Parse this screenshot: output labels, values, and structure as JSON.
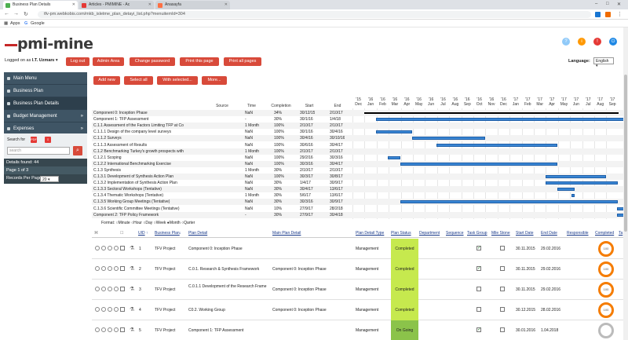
{
  "browser": {
    "tabs": [
      {
        "title": "Business Plan Details",
        "color": "#4caf50"
      },
      {
        "title": "Articles - PMIMINE - Ac",
        "color": "#e53935"
      },
      {
        "title": "Anasayfa",
        "color": "#ff7043"
      }
    ],
    "url": "tfv-pm.webkobis.com/mkb_isletme_plan_detayi_list.php?menuitemId=304",
    "bookmarks": [
      "Apps",
      "Google"
    ]
  },
  "logo": "pmi-mine",
  "header": {
    "logged_prefix": "Logged on as",
    "logged_user": "I.T. Uzmanı",
    "buttons": [
      "Log out",
      "Admin Area",
      "Change password",
      "Print this page",
      "Print all pages"
    ],
    "language_label": "Language:",
    "language_value": "English"
  },
  "sidebar": {
    "items": [
      {
        "label": "Main Menu"
      },
      {
        "label": "Business Plan"
      },
      {
        "label": "Business Plan Details"
      },
      {
        "label": "Budget Management"
      },
      {
        "label": "Expenses"
      }
    ],
    "search_for": "Search for",
    "search_placeholder": "search",
    "details_found": "Details found: 44",
    "page_of": "Page 1 of 3",
    "records_label": "Records Per Page:",
    "records_value": "20"
  },
  "actions": [
    "Add new",
    "Select all",
    "With selected...",
    "More..."
  ],
  "gantt": {
    "columns": [
      "Source",
      "Time",
      "Completion",
      "Start",
      "End"
    ],
    "months": [
      "'15 Dec",
      "'16 Jan",
      "'16 Feb",
      "'16 Mar",
      "'16 Apr",
      "'16 May",
      "'16 Jun",
      "'16 Jul",
      "'16 Aug",
      "'16 Sep",
      "'16 Oct",
      "'16 Nov",
      "'16 Dec",
      "'17 Jan",
      "'17 Feb",
      "'17 Mar",
      "'17 Apr",
      "'17 May",
      "'17 Jun",
      "'17 Jul",
      "'17 Aug",
      "'17 Sep"
    ],
    "rows": [
      {
        "name": "Component 0: Inception Phase",
        "source": "",
        "time": "NaN",
        "comp": "34%",
        "start": "30/12/15",
        "end": "2/10/17"
      },
      {
        "name": "Component 1: TFP Assessment",
        "source": "",
        "time": "-",
        "comp": "30%",
        "start": "30/1/16",
        "end": "1/4/18"
      },
      {
        "name": "C.1.1 Assessment of the Factors Limiting TFP at Co",
        "source": "",
        "time": "1 Month",
        "comp": "100%",
        "start": "2/10/17",
        "end": "2/10/17"
      },
      {
        "name": "C.1.1.1 Design of the company level surveys",
        "source": "",
        "time": "NaN",
        "comp": "100%",
        "start": "30/1/16",
        "end": "30/4/16"
      },
      {
        "name": "C.1.1.2 Surveys",
        "source": "",
        "time": "NaN",
        "comp": "100%",
        "start": "30/4/16",
        "end": "30/10/16"
      },
      {
        "name": "C.1.1.3 Assessment of Results",
        "source": "",
        "time": "NaN",
        "comp": "100%",
        "start": "30/6/16",
        "end": "30/4/17"
      },
      {
        "name": "C.1.2 Benchmarking Turkey's growth prospects with",
        "source": "",
        "time": "1 Month",
        "comp": "100%",
        "start": "2/10/17",
        "end": "2/10/17"
      },
      {
        "name": "C.1.2.1 Scoping",
        "source": "",
        "time": "NaN",
        "comp": "100%",
        "start": "29/2/16",
        "end": "30/3/16"
      },
      {
        "name": "C.1.2.2 International Benchmarking Exercise",
        "source": "",
        "time": "NaN",
        "comp": "100%",
        "start": "30/3/16",
        "end": "30/4/17"
      },
      {
        "name": "C.1.3 Synthesis",
        "source": "",
        "time": "1 Month",
        "comp": "30%",
        "start": "2/10/17",
        "end": "2/10/17"
      },
      {
        "name": "C.1.3.1 Development of Synthesis Action Plan",
        "source": "",
        "time": "NaN",
        "comp": "100%",
        "start": "30/3/17",
        "end": "30/8/17"
      },
      {
        "name": "C.1.3.2 Implementation of Synthesis Action Plan",
        "source": "",
        "time": "NaN",
        "comp": "30%",
        "start": "1/4/17",
        "end": "30/9/17"
      },
      {
        "name": "C.1.3.3 Sectoral Workshops (Tentative)",
        "source": "",
        "time": "NaN",
        "comp": "30%",
        "start": "30/4/17",
        "end": "13/6/17"
      },
      {
        "name": "C.1.3.4 Thematic Workshops (Tentative)",
        "source": "",
        "time": "1 Month",
        "comp": "30%",
        "start": "5/6/17",
        "end": "13/6/17"
      },
      {
        "name": "C.1.3.5 Working Group Meetings (Tentative)",
        "source": "",
        "time": "NaN",
        "comp": "30%",
        "start": "30/3/16",
        "end": "30/9/17"
      },
      {
        "name": "C.1.3.6 Scientific Committee Meetings (Tentative)",
        "source": "",
        "time": "NaN",
        "comp": "10%",
        "start": "27/9/17",
        "end": "28/2/18"
      },
      {
        "name": "Component 2: TFP Policy Framework",
        "source": "",
        "time": "-",
        "comp": "30%",
        "start": "27/9/17",
        "end": "30/4/18"
      }
    ],
    "format_label": "Format:",
    "format_options": [
      "Minute",
      "Hour",
      "Day",
      "Week",
      "Month",
      "Qarter"
    ]
  },
  "table": {
    "headers": [
      "UID",
      "Business Plan",
      "Plan Detail",
      "Main Plan Detail",
      "Plan Detail Type",
      "Plan Status",
      "Department",
      "Sequence",
      "Task Group",
      "Mile Stone",
      "Start Date",
      "End Date",
      "Responsible",
      "Completed",
      "Ta"
    ],
    "rows": [
      {
        "uid": "1",
        "bp": "TFV Project",
        "detail": "Component 0: Inception Phase",
        "main": "",
        "type": "Management",
        "status": "Completed",
        "task": true,
        "mile": false,
        "start": "30.11.2015",
        "end": "29.02.2016",
        "pct": "100"
      },
      {
        "uid": "2",
        "bp": "TFV Project",
        "detail": "C.0.1. Research & Synthesis Framework",
        "main": "Component 0: Inception Phase",
        "type": "Management",
        "status": "Completed",
        "task": true,
        "mile": false,
        "start": "30.11.2015",
        "end": "29.02.2016",
        "pct": "100"
      },
      {
        "uid": "3",
        "bp": "TFV Project",
        "detail": "C.0.1.1 Development of the Research Frame",
        "main": "Component 0: Inception Phase",
        "type": "Management",
        "status": "Completed",
        "task": false,
        "mile": false,
        "start": "30.11.2015",
        "end": "29.02.2016",
        "pct": "100"
      },
      {
        "uid": "4",
        "bp": "TFV Project",
        "detail": "C0.2. Working Group",
        "main": "Component 0: Inception Phase",
        "type": "Management",
        "status": "Completed",
        "task": false,
        "mile": false,
        "start": "30.12.2015",
        "end": "28.02.2016",
        "pct": "100"
      },
      {
        "uid": "5",
        "bp": "TFV Project",
        "detail": "Component 1: TFP Assessment",
        "main": "",
        "type": "Management",
        "status": "On Going",
        "task": true,
        "mile": false,
        "start": "30.01.2016",
        "end": "1.04.2018",
        "pct": ""
      }
    ]
  }
}
